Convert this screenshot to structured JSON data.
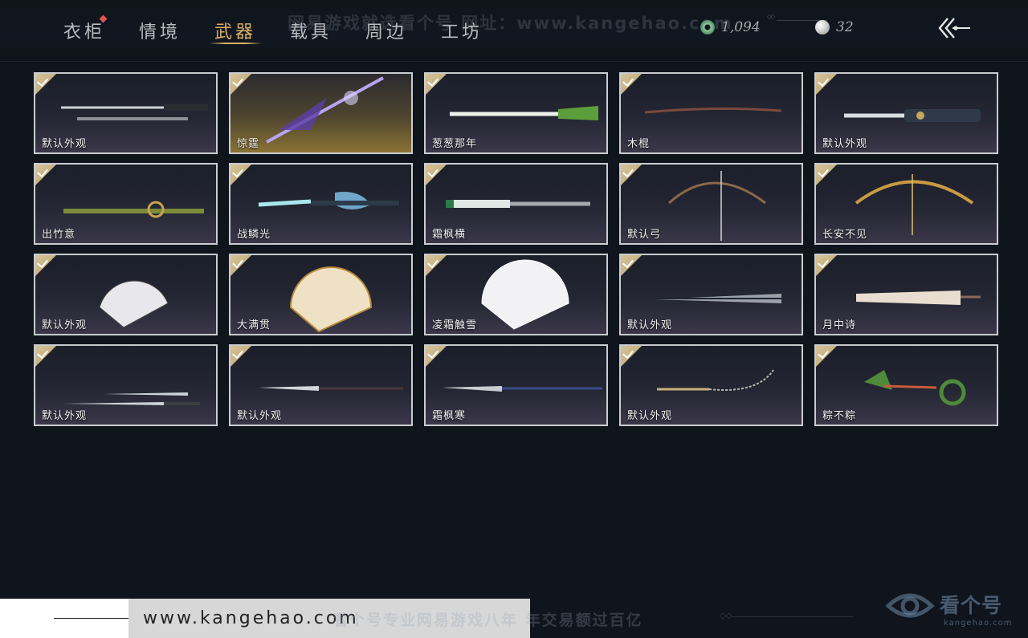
{
  "tabs": [
    {
      "label": "衣柜",
      "has_dot": true
    },
    {
      "label": "情境"
    },
    {
      "label": "武器",
      "active": true
    },
    {
      "label": "载具"
    },
    {
      "label": "周边"
    },
    {
      "label": "工坊"
    }
  ],
  "currency": {
    "jade": {
      "value": "1,094",
      "icon": "jade-coin-icon"
    },
    "silver": {
      "value": "32",
      "icon": "silver-coin-icon"
    }
  },
  "watermark_top": "网易游戏就选看个号  网址：www.kangehao.com",
  "items": [
    {
      "name": "默认外观",
      "art": "sword-pair"
    },
    {
      "name": "惊霆",
      "art": "purple-spear"
    },
    {
      "name": "葱葱那年",
      "art": "scallion"
    },
    {
      "name": "木棍",
      "art": "wooden-staff"
    },
    {
      "name": "默认外观",
      "art": "ornate-blade"
    },
    {
      "name": "出竹意",
      "art": "bamboo"
    },
    {
      "name": "战鳞光",
      "art": "dragon-blade"
    },
    {
      "name": "霜枫横",
      "art": "jade-blade"
    },
    {
      "name": "默认弓",
      "art": "bow"
    },
    {
      "name": "长安不见",
      "art": "gold-bow"
    },
    {
      "name": "默认外观",
      "art": "fan-white"
    },
    {
      "name": "大满贯",
      "art": "fan-gold"
    },
    {
      "name": "凌霜触雪",
      "art": "fan-lace"
    },
    {
      "name": "默认外观",
      "art": "umbrella-striped"
    },
    {
      "name": "月中诗",
      "art": "umbrella-paper"
    },
    {
      "name": "默认外观",
      "art": "twin-sabers"
    },
    {
      "name": "默认外观",
      "art": "long-glaive"
    },
    {
      "name": "霜枫寒",
      "art": "blue-glaive"
    },
    {
      "name": "默认外观",
      "art": "rope-dart"
    },
    {
      "name": "粽不粽",
      "art": "zongzi"
    }
  ],
  "bottom": {
    "url": "www.kangehao.com",
    "slogan": "看个号专业网易游戏八年  年交易额过百亿",
    "brand_name": "看个号",
    "brand_domain": "kangehao.com"
  },
  "colors": {
    "accent": "#d8b068",
    "background": "#0f141d",
    "badge": "#c9b17d",
    "card_border": "#c9ccd0"
  }
}
